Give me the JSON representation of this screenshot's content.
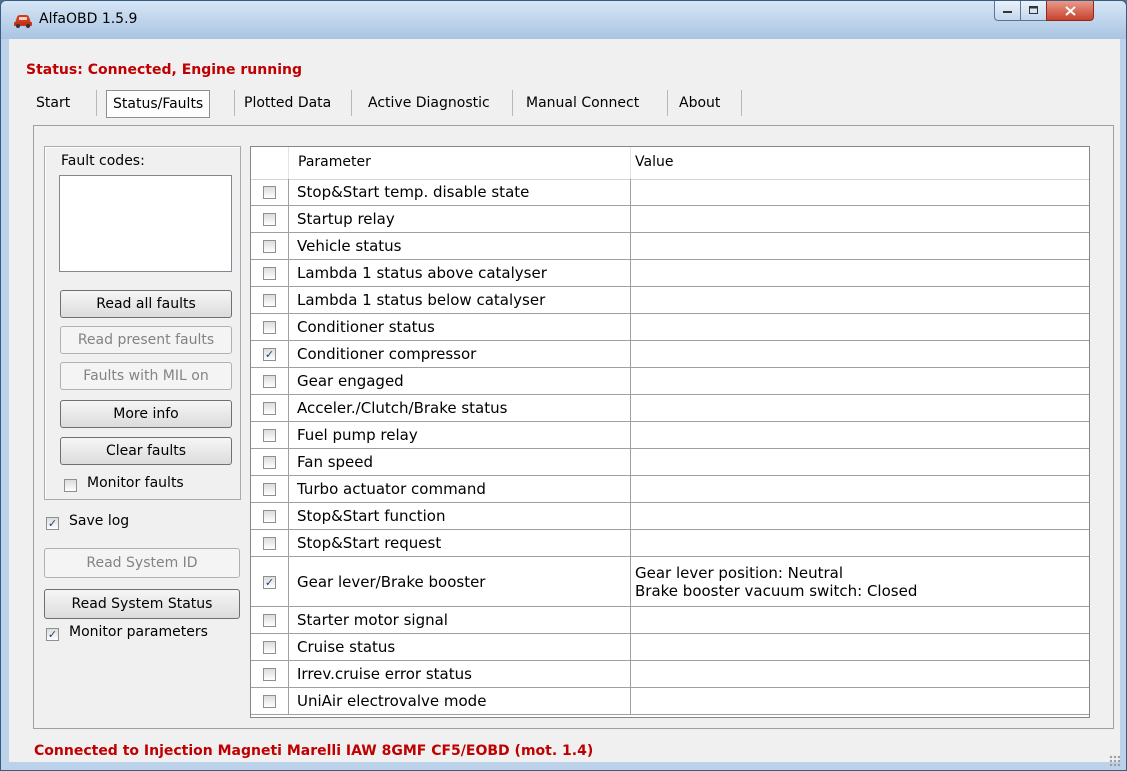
{
  "window": {
    "title": "AlfaOBD 1.5.9"
  },
  "status_top": "Status: Connected, Engine running",
  "tabs": [
    {
      "label": "Start"
    },
    {
      "label": "Status/Faults",
      "active": true
    },
    {
      "label": "Plotted Data"
    },
    {
      "label": "Active Diagnostic"
    },
    {
      "label": "Manual Connect"
    },
    {
      "label": "About"
    }
  ],
  "faults": {
    "label": "Fault codes:",
    "buttons": {
      "read_all": "Read all faults",
      "read_present": "Read present faults",
      "faults_mil": "Faults with MIL on",
      "more_info": "More info",
      "clear": "Clear faults"
    },
    "monitor_faults": {
      "label": "Monitor faults",
      "checked": false
    }
  },
  "save_log": {
    "label": "Save log",
    "checked": true
  },
  "read_system_id": "Read System ID",
  "read_system_status": "Read System Status",
  "monitor_parameters": {
    "label": "Monitor parameters",
    "checked": true
  },
  "grid": {
    "columns": {
      "parameter": "Parameter",
      "value": "Value"
    },
    "rows": [
      {
        "parameter": "Stop&Start temp. disable state",
        "checked": false,
        "value": []
      },
      {
        "parameter": "Startup relay",
        "checked": false,
        "value": []
      },
      {
        "parameter": "Vehicle status",
        "checked": false,
        "value": []
      },
      {
        "parameter": "Lambda 1 status above catalyser",
        "checked": false,
        "value": []
      },
      {
        "parameter": "Lambda 1 status below catalyser",
        "checked": false,
        "value": []
      },
      {
        "parameter": "Conditioner status",
        "checked": false,
        "value": []
      },
      {
        "parameter": "Conditioner compressor",
        "checked": true,
        "value": []
      },
      {
        "parameter": "Gear engaged",
        "checked": false,
        "value": []
      },
      {
        "parameter": "Acceler./Clutch/Brake status",
        "checked": false,
        "value": []
      },
      {
        "parameter": "Fuel pump relay",
        "checked": false,
        "value": []
      },
      {
        "parameter": "Fan speed",
        "checked": false,
        "value": []
      },
      {
        "parameter": "Turbo actuator command",
        "checked": false,
        "value": []
      },
      {
        "parameter": "Stop&Start function",
        "checked": false,
        "value": []
      },
      {
        "parameter": "Stop&Start request",
        "checked": false,
        "value": []
      },
      {
        "parameter": "Gear lever/Brake booster",
        "checked": true,
        "value": [
          "Gear lever position: Neutral",
          "Brake booster vacuum switch: Closed"
        ]
      },
      {
        "parameter": "Starter motor signal",
        "checked": false,
        "value": []
      },
      {
        "parameter": "Cruise status",
        "checked": false,
        "value": []
      },
      {
        "parameter": "Irrev.cruise error status",
        "checked": false,
        "value": []
      },
      {
        "parameter": "UniAir electrovalve mode",
        "checked": false,
        "value": []
      }
    ]
  },
  "status_bottom": "Connected to Injection Magneti Marelli IAW 8GMF CF5/EOBD (mot. 1.4)",
  "colors": {
    "status_red": "#c00000",
    "window_frame": "#bcd2ea"
  }
}
